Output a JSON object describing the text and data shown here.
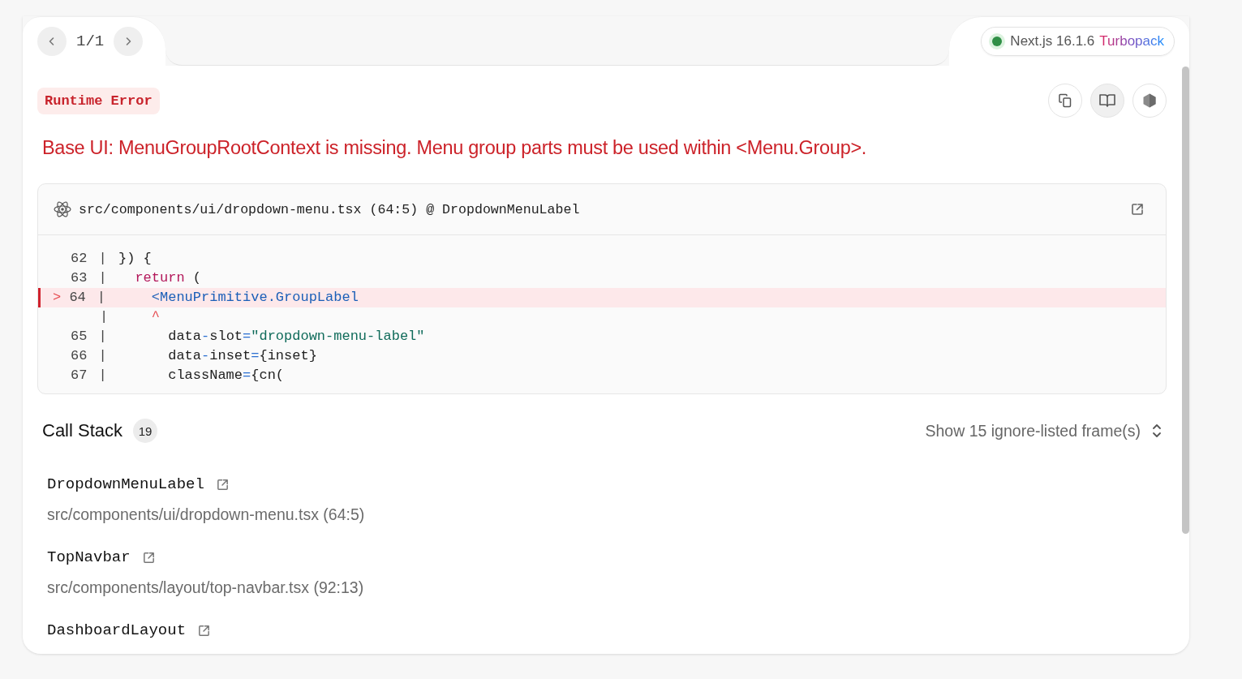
{
  "pager": {
    "position": "1/1"
  },
  "version_badge": {
    "label": "Next.js 16.1.6",
    "bundler": "Turbopack"
  },
  "error_type": "Runtime Error",
  "toolbar": [
    {
      "kind": "copy",
      "selected": false
    },
    {
      "kind": "docs",
      "selected": true
    },
    {
      "kind": "node",
      "selected": false
    }
  ],
  "message": "Base UI: MenuGroupRootContext is missing. Menu group parts must be used within <Menu.Group>.",
  "code_frame": {
    "file": "src/components/ui/dropdown-menu.tsx (64:5) @ DropdownMenuLabel",
    "lines": [
      {
        "kind": "code",
        "number": "62",
        "separator": "|",
        "highlighted": false,
        "tokens": [
          {
            "kind": "plain",
            "text": "}) {"
          }
        ]
      },
      {
        "kind": "code",
        "number": "63",
        "separator": "|",
        "highlighted": false,
        "tokens": [
          {
            "kind": "keyword",
            "text": "  return"
          },
          {
            "kind": "plain",
            "text": " ("
          }
        ]
      },
      {
        "kind": "code",
        "number": "64",
        "separator": "|",
        "highlighted": true,
        "marker": ">",
        "tokens": [
          {
            "kind": "tag",
            "text": "    <MenuPrimitive.GroupLabel"
          }
        ]
      },
      {
        "kind": "caret",
        "separator": "|",
        "highlighted": false,
        "tokens": [
          {
            "kind": "caret",
            "text": "    ^"
          }
        ]
      },
      {
        "kind": "code",
        "number": "65",
        "separator": "|",
        "highlighted": false,
        "tokens": [
          {
            "kind": "plain",
            "text": "      data"
          },
          {
            "kind": "punct",
            "text": "-"
          },
          {
            "kind": "plain",
            "text": "slot"
          },
          {
            "kind": "punct",
            "text": "="
          },
          {
            "kind": "string",
            "text": "\"dropdown-menu-label\""
          }
        ]
      },
      {
        "kind": "code",
        "number": "66",
        "separator": "|",
        "highlighted": false,
        "tokens": [
          {
            "kind": "plain",
            "text": "      data"
          },
          {
            "kind": "punct",
            "text": "-"
          },
          {
            "kind": "plain",
            "text": "inset"
          },
          {
            "kind": "punct",
            "text": "="
          },
          {
            "kind": "plain",
            "text": "{inset}"
          }
        ]
      },
      {
        "kind": "code",
        "number": "67",
        "separator": "|",
        "highlighted": false,
        "tokens": [
          {
            "kind": "plain",
            "text": "      className"
          },
          {
            "kind": "punct",
            "text": "="
          },
          {
            "kind": "plain",
            "text": "{cn("
          }
        ]
      }
    ]
  },
  "call_stack": {
    "title": "Call Stack",
    "count": "19",
    "toggle": "Show 15 ignore-listed frame(s)",
    "frames": [
      {
        "name": "DropdownMenuLabel",
        "location": "src/components/ui/dropdown-menu.tsx (64:5)"
      },
      {
        "name": "TopNavbar",
        "location": "src/components/layout/top-navbar.tsx (92:13)"
      },
      {
        "name": "DashboardLayout"
      }
    ]
  }
}
